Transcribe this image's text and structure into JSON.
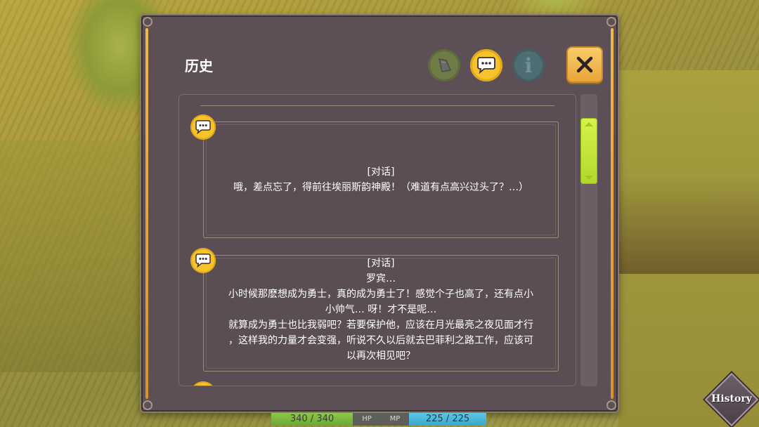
{
  "window": {
    "title": "历史"
  },
  "tabs": [
    {
      "name": "item",
      "icon": "item-tab-icon",
      "active": false
    },
    {
      "name": "dialog",
      "icon": "speech-bubble-icon",
      "active": true
    },
    {
      "name": "info",
      "icon": "info-icon",
      "glyph": "i",
      "active": false
    }
  ],
  "history": {
    "entries": [
      {
        "icon": "speech-bubble-icon",
        "tag": "[对话]",
        "lines": [
          "哦，差点忘了，得前往埃丽斯韵神殿！（难道有点高兴过头了？…）"
        ]
      },
      {
        "icon": "speech-bubble-icon",
        "tag": "[对话]",
        "lines": [
          "罗宾…",
          "小时候那麽想成为勇士，真的成为勇士了！感觉个子也高了，还有点小",
          "小帅气… 呀！才不是呢…",
          "就算成为勇士也比我弱吧？若要保护他，应该在月光最亮之夜见面才行",
          "，这样我的力量才会变强，听说不久以后就去巴菲利之路工作，应该可",
          "以再次相见吧？"
        ]
      }
    ]
  },
  "status": {
    "hp_text": "340 / 340",
    "hp_label": "HP",
    "mp_label": "MP",
    "mp_text": "225 / 225"
  },
  "history_button": {
    "label": "History"
  },
  "colors": {
    "panel": "#5c4f55",
    "accent_yellow": "#f6c42a",
    "scroll_thumb": "#c6e63a",
    "hp_green": "#7ab83e",
    "mp_blue": "#4ab6da"
  }
}
